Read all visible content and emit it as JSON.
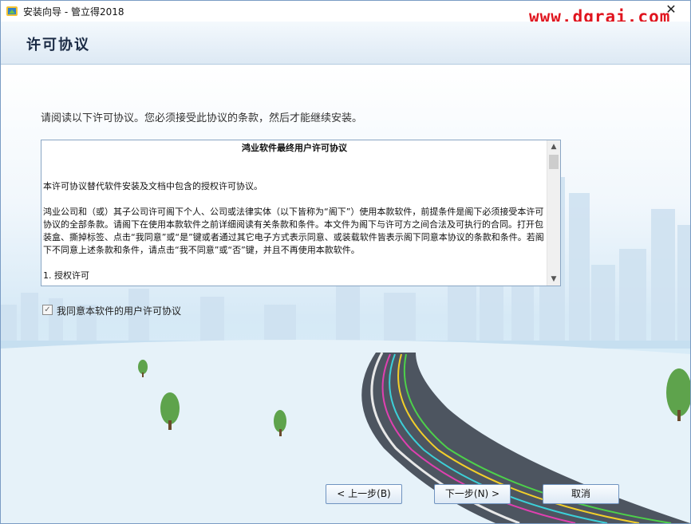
{
  "window": {
    "title": "安装向导 - 管立得2018",
    "watermark": "www.dgrai.com",
    "close_glyph": "✕"
  },
  "header": {
    "title": "许可协议"
  },
  "main": {
    "intro": "请阅读以下许可协议。您必须接受此协议的条款，然后才能继续安装。",
    "license": {
      "heading": "鸿业软件最终用户许可协议",
      "paragraph1": "本许可协议替代软件安装及文档中包含的授权许可协议。",
      "paragraph2": "鸿业公司和（或）其子公司许可阁下个人、公司或法律实体（以下皆称为“阁下”）使用本款软件，前提条件是阁下必须接受本许可协议的全部条款。请阁下在使用本款软件之前详细阅读有关条款和条件。本文件为阁下与许可方之间合法及可执行的合同。打开包装盒、撕掉标签、点击“我同意”或“是”键或者通过其它电子方式表示同意、或装载软件皆表示阁下同意本协议的条款和条件。若阁下不同意上述条款和条件，请点击“我不同意”或“否”键，并且不再使用本款软件。",
      "paragraph3": "1. 授权许可",
      "scroll_up_glyph": "▲",
      "scroll_down_glyph": "▼"
    },
    "agree_checkbox": {
      "label": "我同意本软件的用户许可协议",
      "checked": true,
      "check_glyph": "✓"
    }
  },
  "buttons": {
    "back": "< 上一步(B)",
    "next": "下一步(N) >",
    "cancel": "取消"
  },
  "colors": {
    "watermark": "#e0141e",
    "header_bg": "#dde9f4",
    "button_border": "#6f93c0"
  }
}
